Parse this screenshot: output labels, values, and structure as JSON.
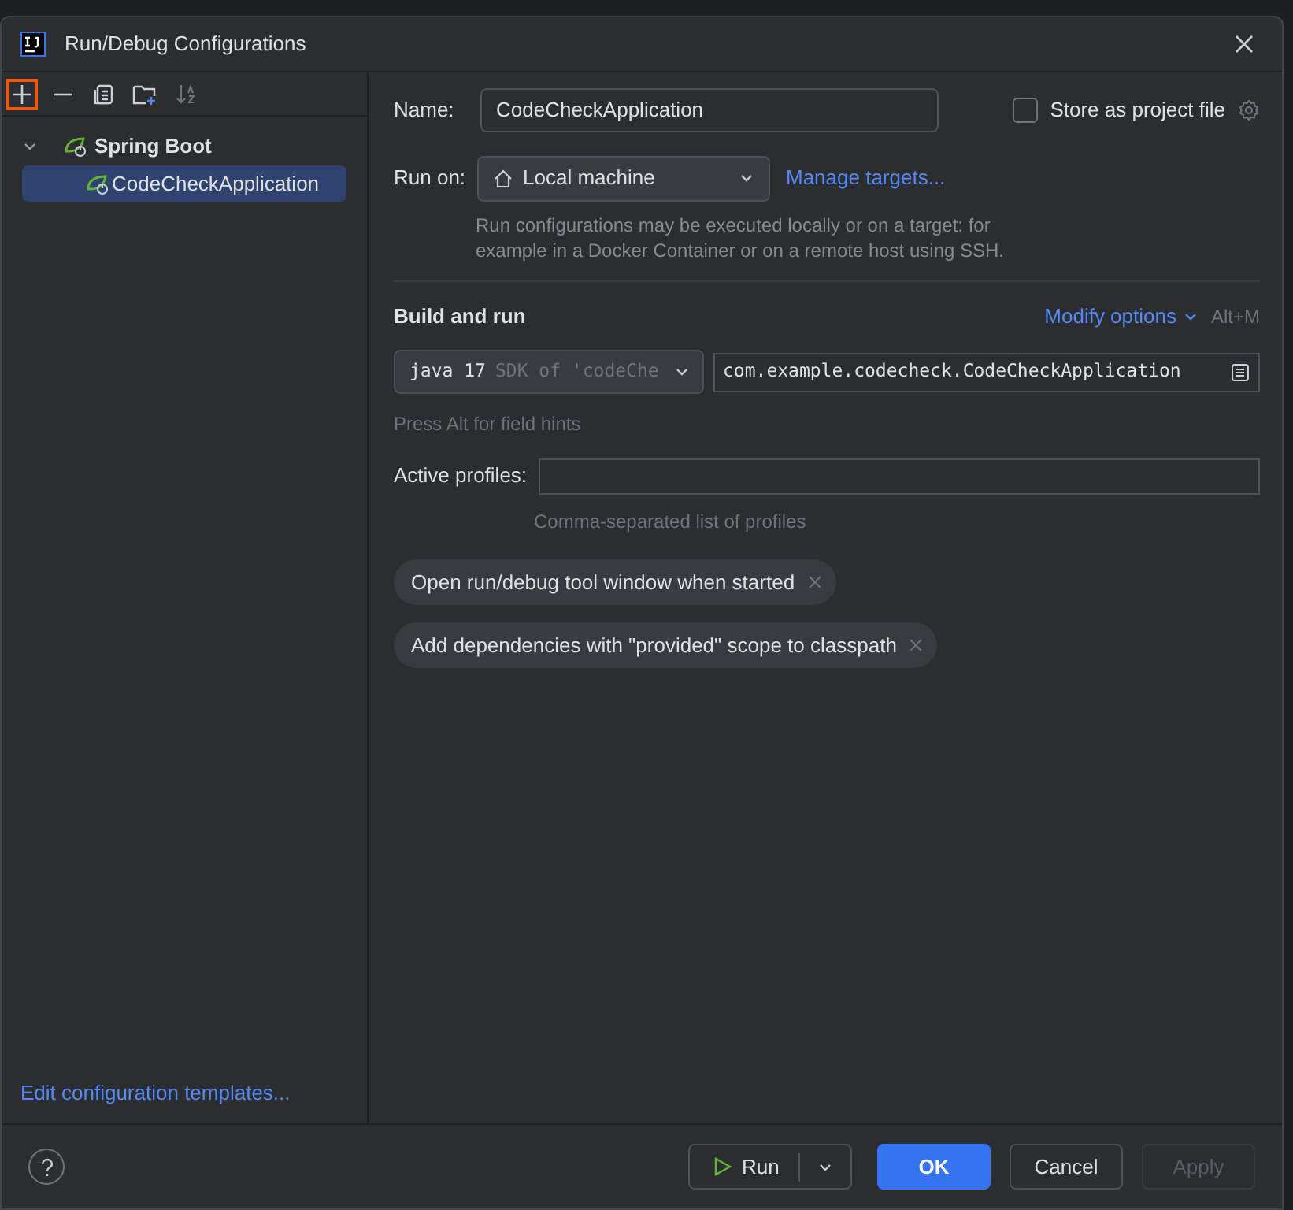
{
  "window": {
    "title": "Run/Debug Configurations"
  },
  "toolbar": [
    {
      "kind": "add",
      "highlighted": true
    },
    {
      "kind": "remove",
      "highlighted": false
    },
    {
      "kind": "copy",
      "highlighted": false
    },
    {
      "kind": "folder",
      "highlighted": false
    },
    {
      "kind": "sort",
      "highlighted": false
    }
  ],
  "tree": [
    {
      "label": "Spring Boot",
      "expanded": true,
      "selected": false,
      "children": [
        {
          "label": "CodeCheckApplication",
          "selected": true
        }
      ]
    }
  ],
  "templates_link": "Edit configuration templates...",
  "name": {
    "label": "Name:",
    "value": "CodeCheckApplication"
  },
  "store": {
    "label": "Store as project file",
    "checked": false
  },
  "run_on": {
    "label": "Run on:",
    "value": "Local machine",
    "link": "Manage targets...",
    "hint": "Run configurations may be executed locally or on a target: for example in a Docker Container or on a remote host using SSH."
  },
  "build": {
    "title": "Build and run",
    "modify": "Modify options",
    "shortcut": "Alt+M",
    "jdk": "java 17",
    "jdk_detail": "SDK of 'codeChe",
    "main_class": "com.example.codecheck.CodeCheckApplication",
    "field_hint": "Press Alt for field hints"
  },
  "profiles": {
    "label": "Active profiles:",
    "hint": "Comma-separated list of profiles"
  },
  "chips": [
    "Open run/debug tool window when started",
    "Add dependencies with \"provided\" scope to classpath"
  ],
  "footer": {
    "run": "Run",
    "ok": "OK",
    "cancel": "Cancel",
    "apply": "Apply",
    "apply_disabled": true
  }
}
